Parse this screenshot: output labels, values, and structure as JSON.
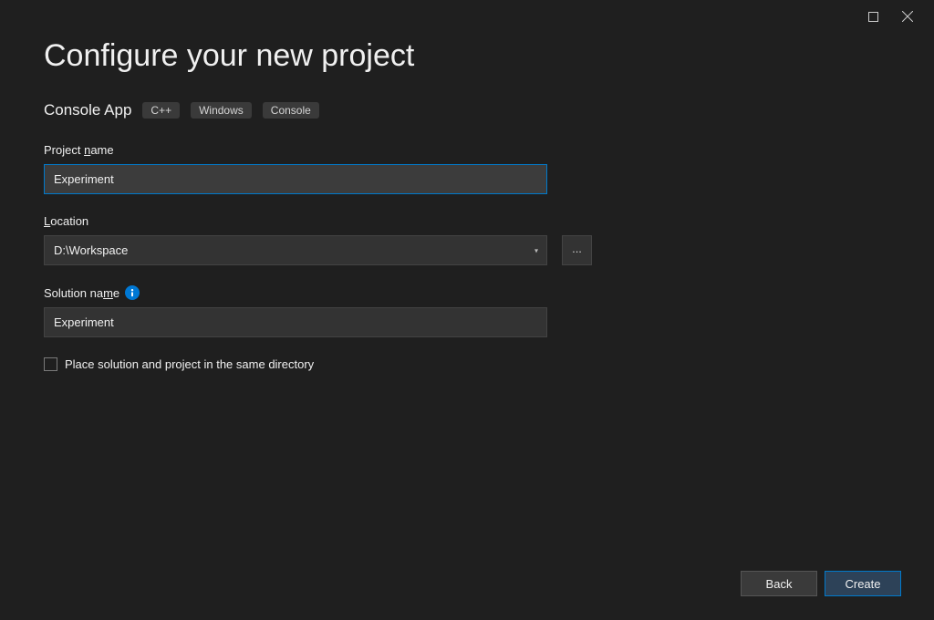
{
  "header": {
    "title": "Configure your new project",
    "subtitle": "Console App",
    "tags": [
      "C++",
      "Windows",
      "Console"
    ]
  },
  "fields": {
    "project_name": {
      "label_pre": "Project ",
      "label_ul": "n",
      "label_post": "ame",
      "value": "Experiment"
    },
    "location": {
      "label_ul": "L",
      "label_post": "ocation",
      "value": "D:\\Workspace",
      "browse": "..."
    },
    "solution_name": {
      "label_pre": "Solution na",
      "label_ul": "m",
      "label_post": "e",
      "value": "Experiment",
      "info": "i"
    },
    "same_dir": {
      "label_pre": "Place solution and project in the same ",
      "label_ul": "d",
      "label_post": "irectory"
    }
  },
  "footer": {
    "back_ul": "B",
    "back_post": "ack",
    "create_ul": "C",
    "create_post": "reate"
  }
}
